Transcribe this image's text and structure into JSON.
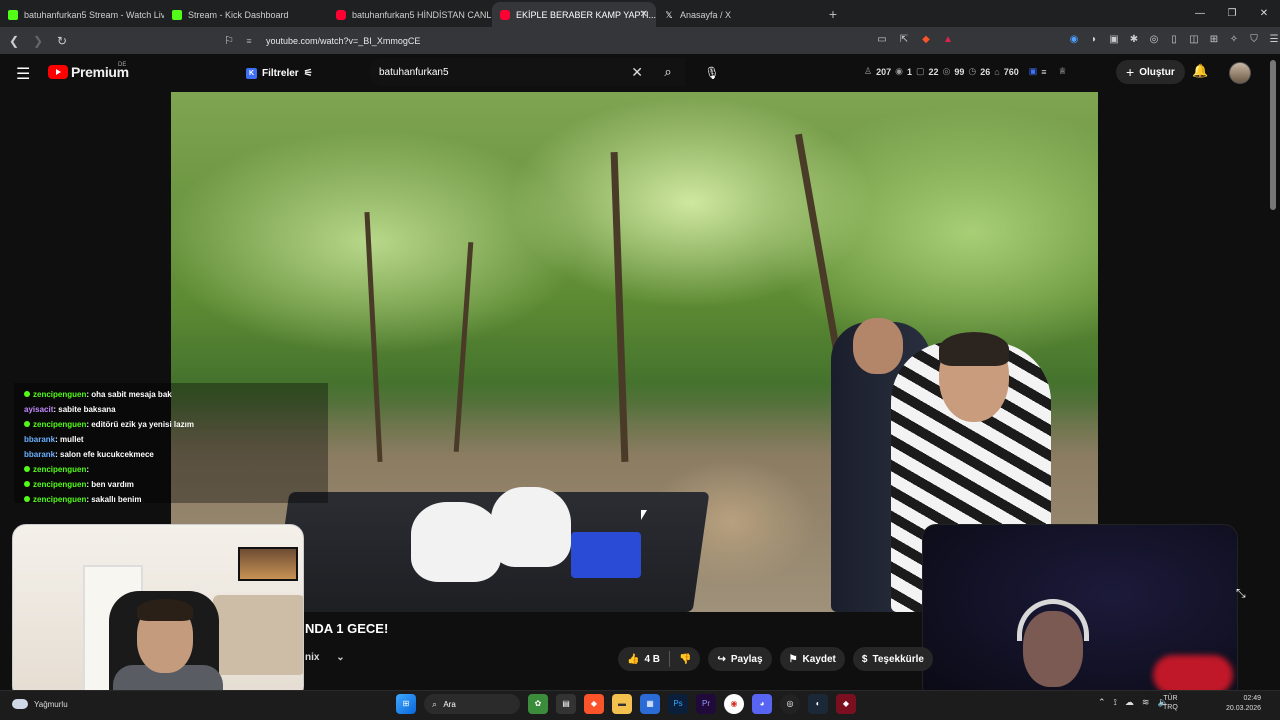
{
  "browser": {
    "tabs": [
      {
        "title": "batuhanfurkan5 Stream - Watch Live...",
        "favicon": "kick-icon",
        "active": false
      },
      {
        "title": "Stream - Kick Dashboard",
        "favicon": "kick-icon",
        "active": false
      },
      {
        "title": "batuhanfurkan5 HİNDİSTAN CANLI Y...",
        "favicon": "youtube-icon",
        "active": false
      },
      {
        "title": "EKİPLE BERABER KAMP YAPTI...",
        "favicon": "youtube-icon",
        "active": true
      },
      {
        "title": "Anasayfa / X",
        "favicon": "x-icon",
        "active": false
      }
    ],
    "new_tab": "+",
    "url": "youtube.com/watch?v=_BI_XmmogCE",
    "window_controls": [
      "—",
      "❐",
      "✕"
    ]
  },
  "youtube": {
    "logo_text": "Premium",
    "country_code": "DE",
    "filters_label": "Filtreler",
    "search_value": "batuhanfurkan5",
    "stats": [
      "207",
      "1",
      "22",
      "99",
      "26",
      "760"
    ],
    "create_label": "Oluştur",
    "video_title": "NDA 1 GECE!",
    "channel_text": "nix",
    "likes": "4 B",
    "share_label": "Paylaş",
    "save_label": "Kaydet",
    "thanks_label": "Teşekkürle"
  },
  "chat": [
    {
      "user": "zencipenguen",
      "msg": ": oha sabit mesaja bak",
      "dot": true,
      "color": "green"
    },
    {
      "user": "ayisacit",
      "msg": ": sabite baksana",
      "dot": false,
      "color": "purple"
    },
    {
      "user": "zencipenguen",
      "msg": ": editörü ezik ya yenisi lazım",
      "dot": true,
      "color": "green"
    },
    {
      "user": "bbarank",
      "msg": ": mullet",
      "dot": false,
      "color": "blue"
    },
    {
      "user": "bbarank",
      "msg": ": salon efe kucukcekmece",
      "dot": false,
      "color": "blue"
    },
    {
      "user": "zencipenguen",
      "msg": ":",
      "dot": true,
      "color": "green"
    },
    {
      "user": "zencipenguen",
      "msg": ": ben vardım",
      "dot": true,
      "color": "green"
    },
    {
      "user": "zencipenguen",
      "msg": ": sakallı benim",
      "dot": true,
      "color": "green"
    }
  ],
  "taskbar": {
    "weather": "Yağmurlu",
    "search_label": "Ara",
    "lang_top": "TÜR",
    "lang_bottom": "TRQ",
    "time": "02:49",
    "date": "20.03.2026"
  }
}
